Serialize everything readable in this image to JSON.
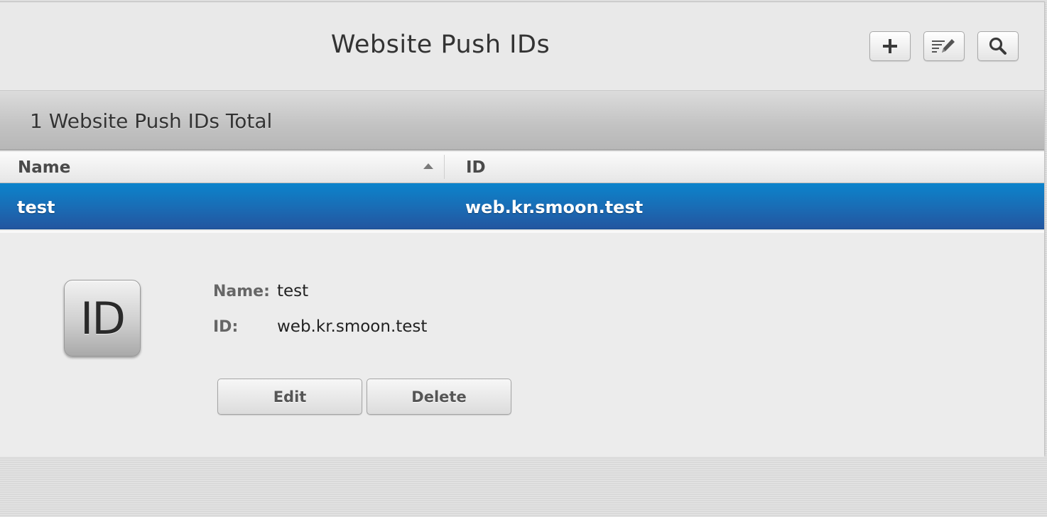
{
  "header": {
    "title": "Website Push IDs",
    "buttons": [
      {
        "icon": "plus-icon"
      },
      {
        "icon": "edit-list-icon"
      },
      {
        "icon": "search-icon"
      }
    ]
  },
  "summary": {
    "count_text": "1 Website Push IDs Total"
  },
  "table": {
    "columns": [
      "Name",
      "ID"
    ],
    "sort": {
      "column": "Name",
      "direction": "ascending"
    },
    "rows": [
      {
        "name": "test",
        "id": "web.kr.smoon.test",
        "selected": true
      }
    ]
  },
  "detail": {
    "icon_text": "ID",
    "fields": [
      {
        "label": "Name:",
        "value": "test"
      },
      {
        "label": "ID:",
        "value": "web.kr.smoon.test"
      }
    ],
    "edit_label": "Edit",
    "delete_label": "Delete"
  },
  "colors": {
    "selection": "#1a6bb4",
    "panel_background": "#ececec"
  }
}
